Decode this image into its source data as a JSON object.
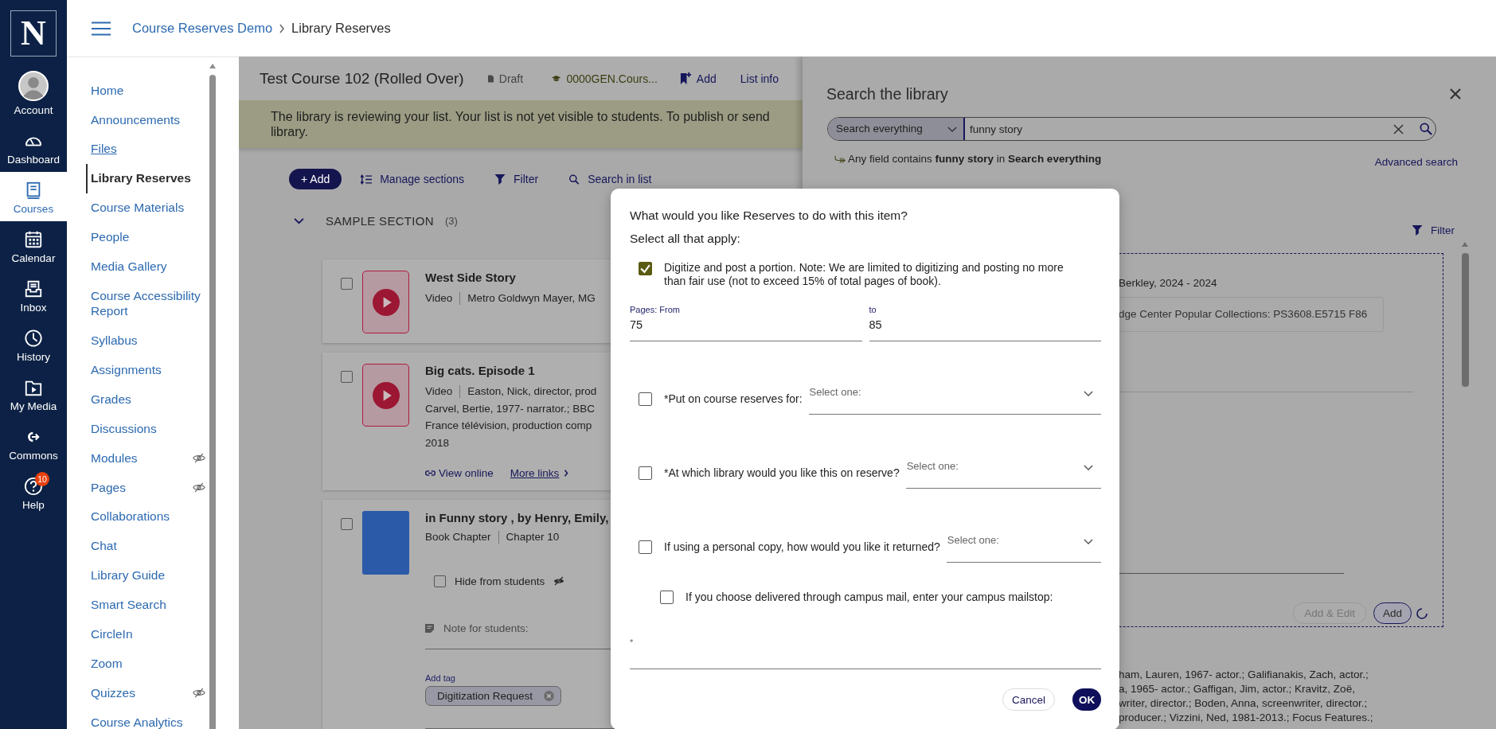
{
  "global_nav": {
    "logo": "N",
    "items": [
      {
        "label": "Account",
        "kind": "avatar",
        "selected": false
      },
      {
        "label": "Dashboard",
        "kind": "gauge",
        "selected": false
      },
      {
        "label": "Courses",
        "kind": "book",
        "selected": true
      },
      {
        "label": "Calendar",
        "kind": "calendar",
        "selected": false
      },
      {
        "label": "Inbox",
        "kind": "inbox",
        "selected": false
      },
      {
        "label": "History",
        "kind": "clock",
        "selected": false
      },
      {
        "label": "My Media",
        "kind": "media",
        "selected": false
      },
      {
        "label": "Commons",
        "kind": "commons",
        "selected": false
      },
      {
        "label": "Help",
        "kind": "help",
        "selected": false,
        "badge": "10"
      }
    ]
  },
  "header": {
    "breadcrumbs": [
      "Course Reserves Demo",
      "Library Reserves"
    ]
  },
  "course_nav": {
    "items": [
      {
        "label": "Home",
        "selected": false,
        "focused": false,
        "hidden": false
      },
      {
        "label": "Announcements",
        "selected": false,
        "focused": false,
        "hidden": false
      },
      {
        "label": "Files",
        "selected": false,
        "focused": true,
        "hidden": false
      },
      {
        "label": "Library Reserves",
        "selected": true,
        "focused": false,
        "hidden": false
      },
      {
        "label": "Course Materials",
        "selected": false,
        "focused": false,
        "hidden": false
      },
      {
        "label": "People",
        "selected": false,
        "focused": false,
        "hidden": false
      },
      {
        "label": "Media Gallery",
        "selected": false,
        "focused": false,
        "hidden": false
      },
      {
        "label": "Course Accessibility Report",
        "selected": false,
        "focused": false,
        "hidden": false
      },
      {
        "label": "Syllabus",
        "selected": false,
        "focused": false,
        "hidden": false
      },
      {
        "label": "Assignments",
        "selected": false,
        "focused": false,
        "hidden": false
      },
      {
        "label": "Grades",
        "selected": false,
        "focused": false,
        "hidden": false
      },
      {
        "label": "Discussions",
        "selected": false,
        "focused": false,
        "hidden": false
      },
      {
        "label": "Modules",
        "selected": false,
        "focused": false,
        "hidden": true
      },
      {
        "label": "Pages",
        "selected": false,
        "focused": false,
        "hidden": true
      },
      {
        "label": "Collaborations",
        "selected": false,
        "focused": false,
        "hidden": false
      },
      {
        "label": "Chat",
        "selected": false,
        "focused": false,
        "hidden": false
      },
      {
        "label": "Library Guide",
        "selected": false,
        "focused": false,
        "hidden": false
      },
      {
        "label": "Smart Search",
        "selected": false,
        "focused": false,
        "hidden": false
      },
      {
        "label": "CircleIn",
        "selected": false,
        "focused": false,
        "hidden": false
      },
      {
        "label": "Zoom",
        "selected": false,
        "focused": false,
        "hidden": false
      },
      {
        "label": "Quizzes",
        "selected": false,
        "focused": false,
        "hidden": true
      },
      {
        "label": "Course Analytics",
        "selected": false,
        "focused": false,
        "hidden": false
      }
    ]
  },
  "list": {
    "title": "Test Course 102 (Rolled Over)",
    "status": "Draft",
    "course_code": "0000GEN.Cours...",
    "add": "Add",
    "list_info": "List info",
    "banner": [
      "The library is reviewing your list. Your list is not yet visible to students. To publish or send",
      "library."
    ],
    "toolbar": {
      "add": "+ Add",
      "manage": "Manage sections",
      "filter": "Filter",
      "search": "Search in list"
    },
    "section": {
      "title": "SAMPLE SECTION",
      "count": "(3)",
      "expanded": true
    },
    "items": [
      {
        "kind": "video",
        "title": "West Side Story",
        "checked": false,
        "meta": [
          "Video",
          "Metro Goldwyn Mayer, MG"
        ]
      },
      {
        "kind": "video",
        "title": "Big cats. Episode 1",
        "checked": false,
        "meta": [
          "Video",
          "Easton, Nick, director, prod"
        ],
        "lines": [
          "Carvel, Bertie, 1977- narrator.; BBC",
          "France télévision, production comp",
          "2018"
        ],
        "links": [
          "View online",
          "More links"
        ]
      },
      {
        "kind": "chapter",
        "title": "in Funny story , by Henry, Emily,",
        "checked": false,
        "meta": [
          "Book Chapter",
          "Chapter 10"
        ],
        "hide": {
          "label": "Hide from students",
          "checked": false
        },
        "note_label": "Note for students:",
        "tag_label": "Add tag",
        "tags": [
          "Digitization Request"
        ]
      }
    ]
  },
  "search_panel": {
    "title": "Search the library",
    "scope": "Search everything",
    "query": "funny story",
    "summary": "Any field contains **funny story** in **Search everything**",
    "advanced": "Advanced search",
    "filter": "Filter",
    "result": {
      "publisher": "Berkley, 2024 - 2024",
      "call_number": "dge Center Popular Collections: PS3608.E5715 F86",
      "buttons": [
        "Add & Edit",
        "Add"
      ],
      "loading": true
    },
    "next_lines": [
      "ham, Lauren, 1967- actor.; Galifianakis, Zach, actor.;",
      "a, 1965- actor.; Gaffigan, Jim, actor.; Kravitz, Zoë,",
      "writer, director.; Boden, Anna, screenwriter, director.;",
      "producer.; Vizzini, Ned, 1981-2013.; Focus Features.;"
    ]
  },
  "dialog": {
    "question": "What would you like Reserves to do with this item?",
    "instruction": "Select all that apply:",
    "options": [
      {
        "kind": "digitize",
        "label": "Digitize and post a portion. Note: We are limited to digitizing and posting no more than fair use (not to exceed 15% of total pages of book).",
        "checked": true,
        "from_label": "Pages: From",
        "from_value": "75",
        "to_label": "to",
        "to_value": "85"
      },
      {
        "kind": "select",
        "label": "*Put on course reserves for:",
        "checked": false,
        "placeholder": "Select one:"
      },
      {
        "kind": "select",
        "label": "*At which library would you like this on reserve?",
        "checked": false,
        "placeholder": "Select one:"
      },
      {
        "kind": "select",
        "label": "If using a personal copy, how would you like it returned?",
        "checked": false,
        "placeholder": "Select one:"
      },
      {
        "kind": "mailstop",
        "label": "If you choose delivered through campus mail, enter your campus mailstop:",
        "checked": false,
        "field_label": "*"
      }
    ],
    "buttons": {
      "cancel": "Cancel",
      "ok": "OK"
    }
  }
}
